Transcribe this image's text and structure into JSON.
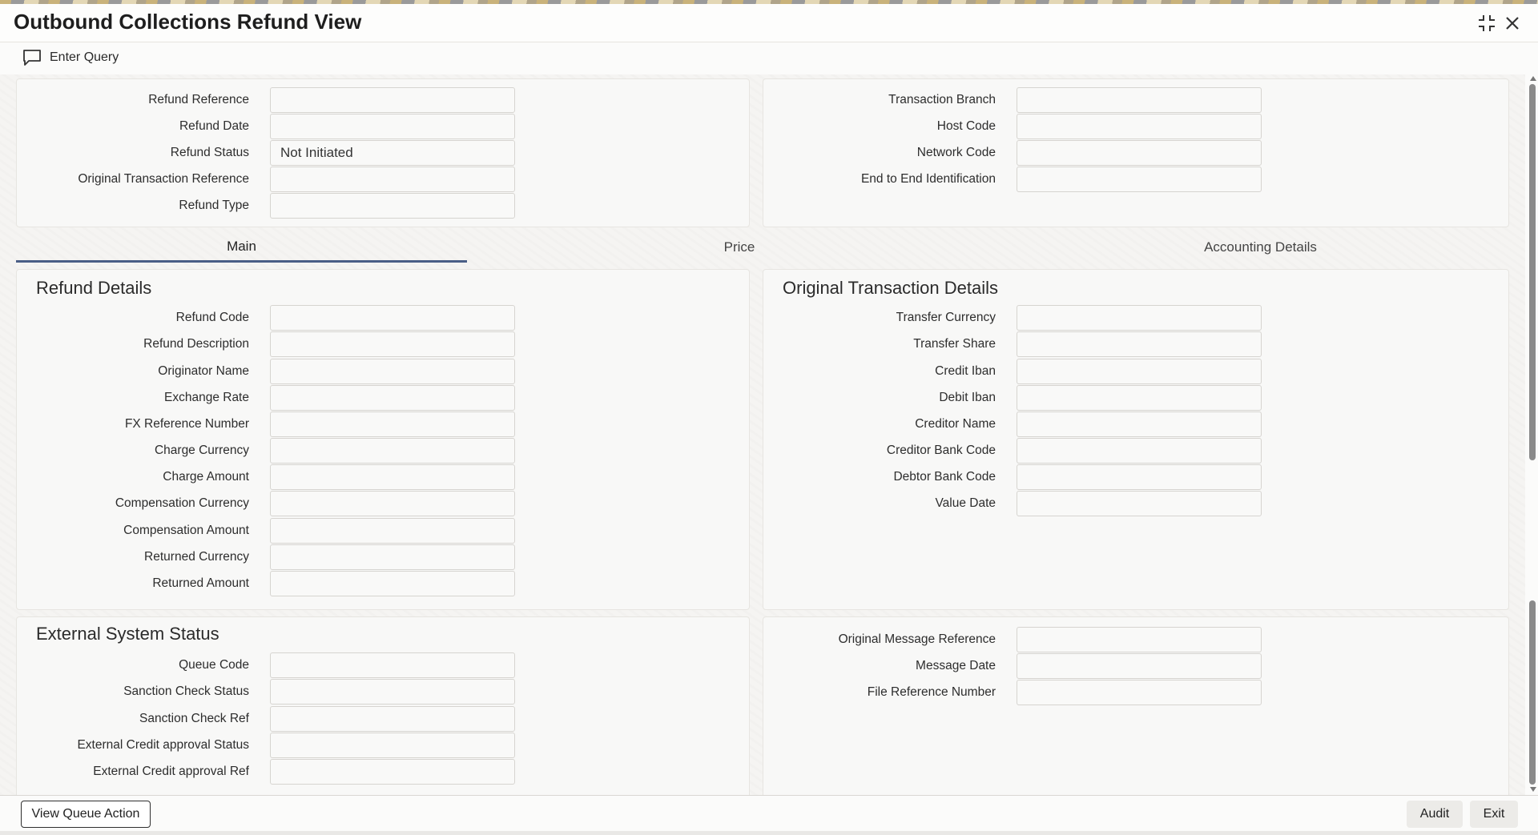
{
  "window": {
    "title": "Outbound Collections Refund View"
  },
  "toolbar": {
    "enter_query_label": "Enter Query"
  },
  "header_left": {
    "fields": [
      {
        "label": "Refund Reference",
        "value": ""
      },
      {
        "label": "Refund Date",
        "value": ""
      },
      {
        "label": "Refund Status",
        "value": "Not Initiated"
      },
      {
        "label": "Original Transaction Reference",
        "value": ""
      },
      {
        "label": "Refund Type",
        "value": ""
      }
    ]
  },
  "header_right": {
    "fields": [
      {
        "label": "Transaction Branch",
        "value": ""
      },
      {
        "label": "Host Code",
        "value": ""
      },
      {
        "label": "Network Code",
        "value": ""
      },
      {
        "label": "End to End Identification",
        "value": ""
      }
    ]
  },
  "tabs": [
    {
      "label": "Main"
    },
    {
      "label": "Price"
    },
    {
      "label": "Accounting Details"
    }
  ],
  "refund_details": {
    "title": "Refund Details",
    "fields": [
      {
        "label": "Refund Code",
        "value": ""
      },
      {
        "label": "Refund Description",
        "value": ""
      },
      {
        "label": "Originator Name",
        "value": ""
      },
      {
        "label": "Exchange Rate",
        "value": ""
      },
      {
        "label": "FX Reference Number",
        "value": ""
      },
      {
        "label": "Charge Currency",
        "value": ""
      },
      {
        "label": "Charge Amount",
        "value": ""
      },
      {
        "label": "Compensation Currency",
        "value": ""
      },
      {
        "label": "Compensation Amount",
        "value": ""
      },
      {
        "label": "Returned Currency",
        "value": ""
      },
      {
        "label": "Returned Amount",
        "value": ""
      }
    ]
  },
  "original_transaction": {
    "title": "Original Transaction Details",
    "fields": [
      {
        "label": "Transfer Currency",
        "value": ""
      },
      {
        "label": "Transfer Share",
        "value": ""
      },
      {
        "label": "Credit Iban",
        "value": ""
      },
      {
        "label": "Debit Iban",
        "value": ""
      },
      {
        "label": "Creditor Name",
        "value": ""
      },
      {
        "label": "Creditor Bank Code",
        "value": ""
      },
      {
        "label": "Debtor Bank Code",
        "value": ""
      },
      {
        "label": "Value Date",
        "value": ""
      }
    ]
  },
  "external_system_status": {
    "title": "External System Status",
    "fields": [
      {
        "label": "Queue Code",
        "value": ""
      },
      {
        "label": "Sanction Check Status",
        "value": ""
      },
      {
        "label": "Sanction Check Ref",
        "value": ""
      },
      {
        "label": "External Credit approval Status",
        "value": ""
      },
      {
        "label": "External Credit approval Ref",
        "value": ""
      }
    ]
  },
  "message_info": {
    "fields": [
      {
        "label": "Original Message Reference",
        "value": ""
      },
      {
        "label": "Message Date",
        "value": ""
      },
      {
        "label": "File Reference Number",
        "value": ""
      }
    ]
  },
  "footer": {
    "view_queue_action_label": "View Queue Action",
    "audit_label": "Audit",
    "exit_label": "Exit"
  },
  "colors": {
    "accent_tab_underline": "#4a5e86",
    "title_text": "#1e1e1e"
  }
}
